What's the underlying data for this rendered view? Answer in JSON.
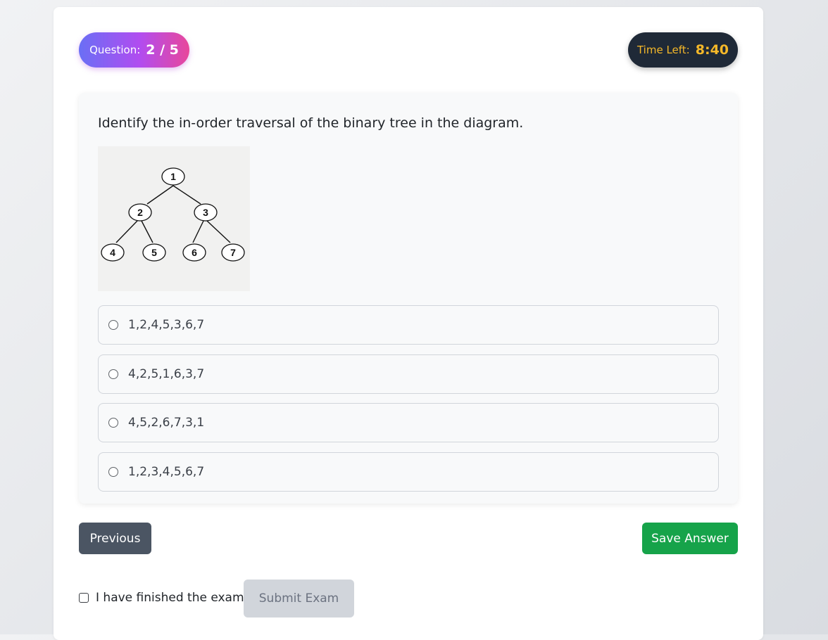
{
  "header": {
    "question_label": "Question:",
    "question_value": "2 / 5",
    "timer_label": "Time Left:",
    "timer_value": "8:40"
  },
  "question": {
    "text": "Identify the in-order traversal of the binary tree in the diagram.",
    "diagram": {
      "nodes": [
        "1",
        "2",
        "3",
        "4",
        "5",
        "6",
        "7"
      ]
    },
    "options": [
      {
        "label": "1,2,4,5,3,6,7"
      },
      {
        "label": "4,2,5,1,6,3,7"
      },
      {
        "label": "4,5,2,6,7,3,1"
      },
      {
        "label": "1,2,3,4,5,6,7"
      }
    ]
  },
  "nav": {
    "previous_label": "Previous",
    "save_label": "Save Answer"
  },
  "footer": {
    "finished_label": "I have finished the exam",
    "submit_label": "Submit Exam"
  },
  "colors": {
    "save": "#16a34a",
    "previous": "#4b5563",
    "timer_bg": "#1f2937",
    "timer_text": "#f5b829"
  }
}
